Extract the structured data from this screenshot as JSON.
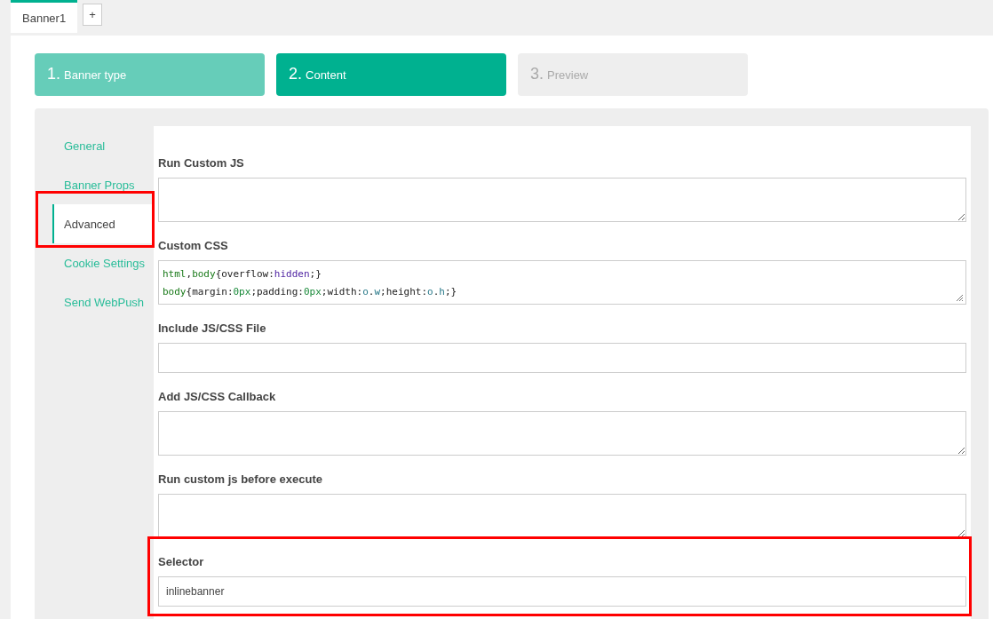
{
  "tabs": [
    {
      "label": "Banner1",
      "selected": true
    }
  ],
  "add_tab_button": "+",
  "steps": [
    {
      "number": "1.",
      "label": "Banner type",
      "selected": false
    },
    {
      "number": "2.",
      "label": "Content",
      "selected": true
    },
    {
      "number": "3.",
      "label": "Preview",
      "selected": false
    }
  ],
  "nav": [
    {
      "label": "General",
      "selected": false,
      "highlighted": false
    },
    {
      "label": "Banner Props",
      "selected": false,
      "highlighted": false
    },
    {
      "label": "Advanced",
      "selected": true,
      "highlighted": true
    },
    {
      "label": "Cookie Settings",
      "selected": false,
      "highlighted": false
    },
    {
      "label": "Send WebPush",
      "selected": false,
      "highlighted": false
    }
  ],
  "fields": [
    {
      "label": "Run Custom JS",
      "kind": "textarea",
      "highlighted": false
    },
    {
      "label": "Custom CSS",
      "kind": "code",
      "highlighted": false,
      "lines": [
        "html,body{overflow:hidden;}",
        "body{margin:0px;padding:0px;width:o.w;height:o.h;}"
      ]
    },
    {
      "label": "Include JS/CSS File",
      "kind": "input",
      "highlighted": false
    },
    {
      "label": "Add JS/CSS Callback",
      "kind": "textarea",
      "highlighted": false
    },
    {
      "label": "Run custom js before execute",
      "kind": "textarea",
      "highlighted": false
    },
    {
      "label": "Selector",
      "kind": "input",
      "value": "inlinebanner",
      "highlighted": true
    }
  ]
}
